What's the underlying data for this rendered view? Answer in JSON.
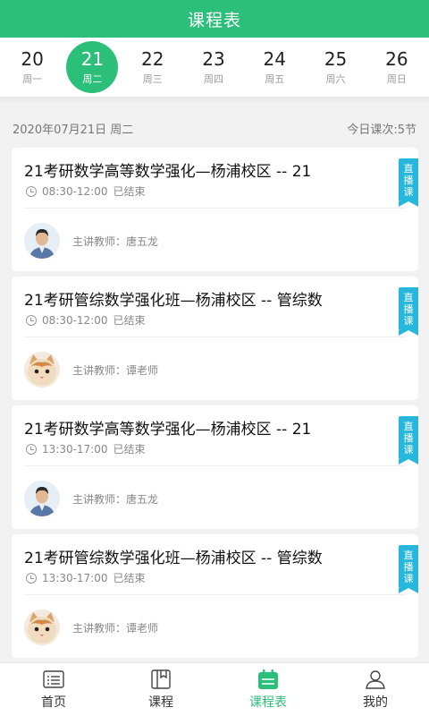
{
  "header": {
    "title": "课程表"
  },
  "week": [
    {
      "num": "20",
      "weekday": "周一"
    },
    {
      "num": "21",
      "weekday": "周二"
    },
    {
      "num": "22",
      "weekday": "周三"
    },
    {
      "num": "23",
      "weekday": "周四"
    },
    {
      "num": "24",
      "weekday": "周五"
    },
    {
      "num": "25",
      "weekday": "周六"
    },
    {
      "num": "26",
      "weekday": "周日"
    }
  ],
  "selected_day_index": 1,
  "dateline": {
    "date": "2020年07月21日 周二",
    "count": "今日课次:5节"
  },
  "courses": [
    {
      "title": "21考研数学高等数学强化—杨浦校区 -- 21",
      "time": "08:30-12:00",
      "status": "已结束",
      "teacher": "主讲教师：唐五龙",
      "ribbon": [
        "直",
        "播",
        "课"
      ],
      "avatar": "man-avatar"
    },
    {
      "title": "21考研管综数学强化班—杨浦校区 -- 管综数",
      "time": "08:30-12:00",
      "status": "已结束",
      "teacher": "主讲教师：谭老师",
      "ribbon": [
        "直",
        "播",
        "课"
      ],
      "avatar": "cat-avatar"
    },
    {
      "title": "21考研数学高等数学强化—杨浦校区 -- 21",
      "time": "13:30-17:00",
      "status": "已结束",
      "teacher": "主讲教师：唐五龙",
      "ribbon": [
        "直",
        "播",
        "课"
      ],
      "avatar": "man-avatar"
    },
    {
      "title": "21考研管综数学强化班—杨浦校区 -- 管综数",
      "time": "13:30-17:00",
      "status": "已结束",
      "teacher": "主讲教师：谭老师",
      "ribbon": [
        "直",
        "播",
        "课"
      ],
      "avatar": "cat-avatar"
    }
  ],
  "tabs": [
    {
      "label": "首页",
      "icon": "home-list-icon"
    },
    {
      "label": "课程",
      "icon": "course-book-icon"
    },
    {
      "label": "课程表",
      "icon": "schedule-calendar-icon"
    },
    {
      "label": "我的",
      "icon": "profile-person-icon"
    }
  ],
  "active_tab_index": 2,
  "colors": {
    "primary": "#2bbf7a",
    "ribbon": "#27b7dd"
  }
}
